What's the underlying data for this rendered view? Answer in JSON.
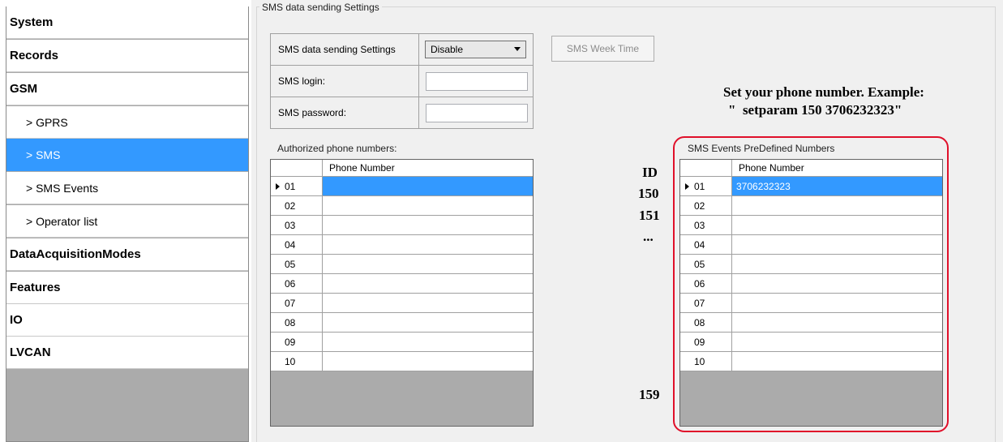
{
  "sidebar": {
    "items": [
      {
        "label": "System"
      },
      {
        "label": "Records"
      },
      {
        "label": "GSM"
      },
      {
        "label": "> GPRS"
      },
      {
        "label": "> SMS"
      },
      {
        "label": "> SMS Events"
      },
      {
        "label": "> Operator list"
      },
      {
        "label": "DataAcquisitionModes"
      },
      {
        "label": "Features"
      },
      {
        "label": "IO"
      },
      {
        "label": "LVCAN"
      }
    ]
  },
  "group_title": "SMS data sending Settings",
  "settings": {
    "sending_label": "SMS data sending Settings",
    "sending_value": "Disable",
    "login_label": "SMS login:",
    "login_value": "",
    "password_label": "SMS password:",
    "password_value": ""
  },
  "week_time_button": "SMS Week Time",
  "authorized": {
    "caption": "Authorized phone numbers:",
    "column": "Phone Number",
    "rows": [
      {
        "id": "01",
        "value": ""
      },
      {
        "id": "02",
        "value": ""
      },
      {
        "id": "03",
        "value": ""
      },
      {
        "id": "04",
        "value": ""
      },
      {
        "id": "05",
        "value": ""
      },
      {
        "id": "06",
        "value": ""
      },
      {
        "id": "07",
        "value": ""
      },
      {
        "id": "08",
        "value": ""
      },
      {
        "id": "09",
        "value": ""
      },
      {
        "id": "10",
        "value": ""
      }
    ]
  },
  "predefined": {
    "caption": "SMS Events PreDefined Numbers",
    "column": "Phone Number",
    "rows": [
      {
        "id": "01",
        "value": "3706232323"
      },
      {
        "id": "02",
        "value": ""
      },
      {
        "id": "03",
        "value": ""
      },
      {
        "id": "04",
        "value": ""
      },
      {
        "id": "05",
        "value": ""
      },
      {
        "id": "06",
        "value": ""
      },
      {
        "id": "07",
        "value": ""
      },
      {
        "id": "08",
        "value": ""
      },
      {
        "id": "09",
        "value": ""
      },
      {
        "id": "10",
        "value": ""
      }
    ]
  },
  "annotation": {
    "line1": "Set your phone number. Example:",
    "line2": "\"  setparam 150 3706232323\"",
    "id_header": "ID",
    "id_first": "150",
    "id_second": "151",
    "ellipsis": "...",
    "id_last": "159"
  },
  "colors": {
    "selection": "#3399ff",
    "highlight_box": "#e0102a"
  }
}
